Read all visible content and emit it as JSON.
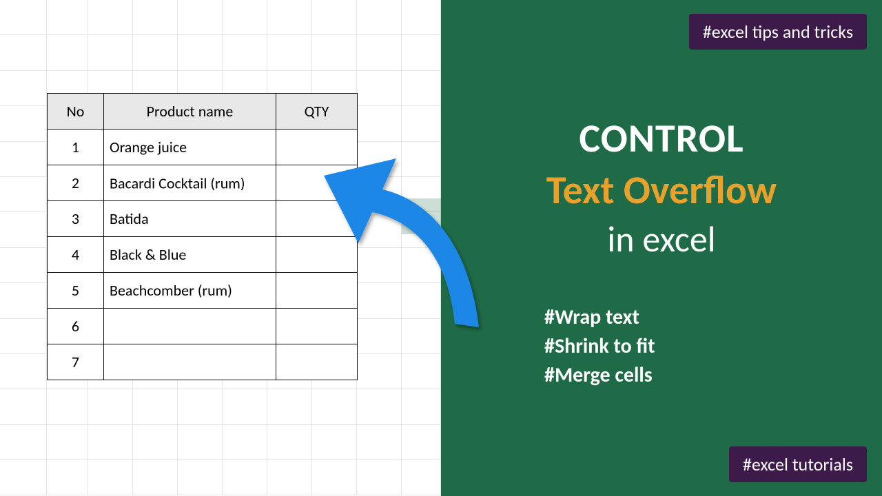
{
  "tags": {
    "top": "#excel tips and tricks",
    "bottom": "#excel tutorials"
  },
  "title": {
    "line1": "CONTROL",
    "line2": "Text Overflow",
    "line3": "in excel"
  },
  "bullets": {
    "b1": "#Wrap text",
    "b2": "#Shrink to fit",
    "b3": "#Merge cells"
  },
  "table": {
    "headers": {
      "no": "No",
      "name": "Product name",
      "qty": "QTY"
    },
    "rows": [
      {
        "no": "1",
        "name": "Orange juice",
        "qty": ""
      },
      {
        "no": "2",
        "name": "Bacardi Cocktail (rum)",
        "qty": ""
      },
      {
        "no": "3",
        "name": "Batida",
        "qty": ""
      },
      {
        "no": "4",
        "name": "Black & Blue",
        "qty": ""
      },
      {
        "no": "5",
        "name": "Beachcomber (rum)",
        "qty": ""
      },
      {
        "no": "6",
        "name": "",
        "qty": ""
      },
      {
        "no": "7",
        "name": "",
        "qty": ""
      }
    ]
  }
}
